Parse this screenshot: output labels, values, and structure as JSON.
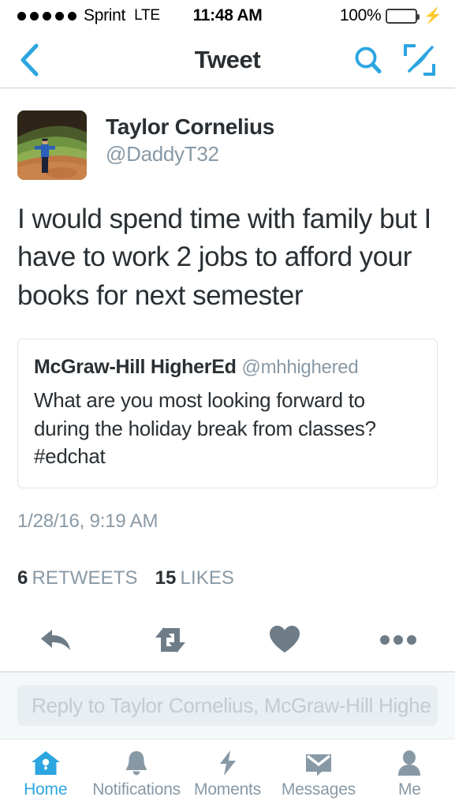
{
  "status_bar": {
    "signal_dots": 5,
    "carrier": "Sprint",
    "network": "LTE",
    "time": "11:48 AM",
    "battery_percent": "100%",
    "charging_icon": "lightning-bolt-icon",
    "battery_color": "#4ADE62"
  },
  "nav": {
    "back_icon": "chevron-left-icon",
    "title": "Tweet",
    "search_icon": "search-icon",
    "compose_icon": "compose-quill-icon",
    "accent_color": "#2CA5E0"
  },
  "tweet": {
    "avatar_alt": "baseball-field-avatar",
    "author_name": "Taylor Cornelius",
    "author_handle": "@DaddyT32",
    "text": "I would spend time with family but I have to work 2 jobs to afford your books for next semester",
    "timestamp": "1/28/16, 9:19 AM",
    "stats": {
      "retweets_count": "6",
      "retweets_label": "RETWEETS",
      "likes_count": "15",
      "likes_label": "LIKES"
    }
  },
  "quoted_tweet": {
    "author_name": "McGraw-Hill HigherEd",
    "author_handle": "@mhhighered",
    "text": "What are you most looking forward to during the holiday break from classes? #edchat"
  },
  "actions": [
    {
      "name": "reply-icon"
    },
    {
      "name": "retweet-icon"
    },
    {
      "name": "like-heart-icon"
    },
    {
      "name": "more-dots-icon"
    }
  ],
  "reply": {
    "placeholder": "Reply to Taylor Cornelius, McGraw-Hill Highe"
  },
  "tab_bar": {
    "items": [
      {
        "label": "Home",
        "icon": "home-birdhouse-icon",
        "active": true
      },
      {
        "label": "Notifications",
        "icon": "bell-icon",
        "active": false
      },
      {
        "label": "Moments",
        "icon": "lightning-bolt-icon",
        "active": false
      },
      {
        "label": "Messages",
        "icon": "envelope-icon",
        "active": false
      },
      {
        "label": "Me",
        "icon": "person-icon",
        "active": false
      }
    ]
  }
}
